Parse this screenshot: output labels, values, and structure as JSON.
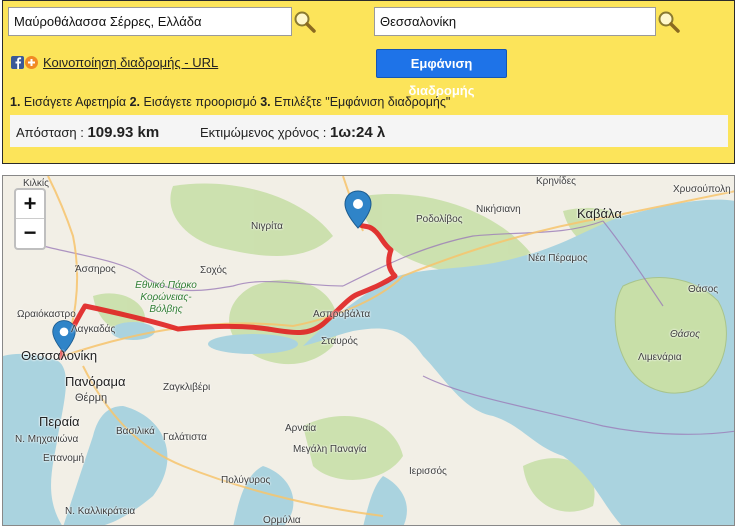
{
  "origin": {
    "value": "Μαύροθάλασσα Σέρρες, Ελλάδα"
  },
  "destination": {
    "value": "Θεσσαλονίκη"
  },
  "share_link": "Κοινοποίηση διαδρομής - URL",
  "show_route_button": "Εμφάνιση διαδρομής",
  "steps": {
    "n1": "1.",
    "t1": " Εισάγετε Αφετηρία ",
    "n2": "2.",
    "t2": " Εισάγετε προορισμό ",
    "n3": "3.",
    "t3": " Επιλέξτε \"Εμφάνιση διαδρομής\""
  },
  "result": {
    "distance_label": "Απόσταση :",
    "distance_value": "109.93 km",
    "time_label": "Εκτιμώμενος χρόνος :",
    "time_value": "1ω:24 λ"
  },
  "map": {
    "zoom_in": "+",
    "zoom_out": "−",
    "places": {
      "kilkis": "Κιλκίς",
      "nigrita": "Νιγρίτα",
      "rodolivos": "Ροδολίβος",
      "nikisiani": "Νικήσιανη",
      "kavala": "Καβάλα",
      "chrysoupoli": "Χρυσούπολη",
      "krinides": "Κρηνίδες",
      "assiros": "Άσσηρος",
      "sochos": "Σοχός",
      "nea_peramos": "Νέα Πέραμος",
      "thasos1": "Θάσος",
      "thasos2": "Θάσος",
      "oraiokastro": "Ωραιόκαστρο",
      "lagkadas": "Λαγκαδάς",
      "asprovalta": "Ασπροβάλτα",
      "stavros": "Σταυρός",
      "thessaloniki": "Θεσσαλονίκη",
      "panorama": "Πανόραμα",
      "thermi": "Θέρμη",
      "zagkliveri": "Ζαγκλιβέρι",
      "limenaria": "Λιμενάρια",
      "peraia": "Περαία",
      "vasilika": "Βασιλικά",
      "galatista": "Γαλάτιστα",
      "arnaia": "Αρναία",
      "megali_panagia": "Μεγάλη Παναγία",
      "ierissos": "Ιερισσός",
      "epanomi": "Επανομή",
      "polygyros": "Πολύγυρος",
      "n_michaniona": "Ν. Μηχανιώνα",
      "n_kallikrateia": "Ν. Καλλικράτεια",
      "ormylia": "Ορμύλια",
      "park": "Εθνικό Πάρκο Κορώνειας-Βόλβης"
    },
    "route_color": "#e02020",
    "water_color": "#aad3df",
    "land_color": "#f2efe6",
    "forest_color": "#c8dfa8",
    "marker_color": "#2f84c8"
  }
}
